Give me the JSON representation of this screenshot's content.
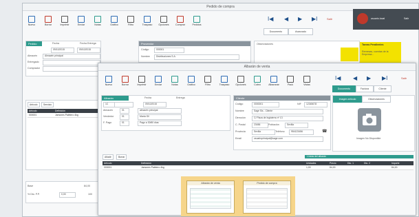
{
  "colors": {
    "accent": "#2e9b8d",
    "topbar": "#444b52",
    "highlight": "#f3e200",
    "preview_bg": "#f6d58a"
  },
  "back_window": {
    "title": "Pedido de compra",
    "toolbar": [
      {
        "label": "Nuevo",
        "icon": "new-doc-icon",
        "color": "#2f6db5"
      },
      {
        "label": "Borrar",
        "icon": "delete-doc-icon",
        "color": "#c0392b"
      },
      {
        "label": "Imprimir",
        "icon": "print-icon",
        "color": "#555"
      },
      {
        "label": "Enviar",
        "icon": "mail-icon",
        "color": "#2f6db5"
      },
      {
        "label": "Notas",
        "icon": "notes-icon",
        "color": "#2e9b8d"
      },
      {
        "label": "Gráfico",
        "icon": "chart-icon",
        "color": "#2f6db5"
      },
      {
        "label": "Filtro",
        "icon": "filter-icon",
        "color": "#555"
      },
      {
        "label": "Traspaso",
        "icon": "transfer-icon",
        "color": "#2f6db5"
      },
      {
        "label": "Opciones",
        "icon": "gear-icon",
        "color": "#555"
      },
      {
        "label": "Comprar",
        "icon": "cart-icon",
        "color": "#c0392b"
      },
      {
        "label": "Pedidos",
        "icon": "orders-icon",
        "color": "#2e9b8d"
      }
    ],
    "nav": {
      "first": "I◀",
      "prev": "◀",
      "next": "▶",
      "last": "▶I",
      "exit": "Salir"
    },
    "nav_tabs": [
      "Documento",
      "Avanzado"
    ],
    "order": {
      "header": "Pedido",
      "fecha_label": "Fecha",
      "fecha": "09/10/2015",
      "entrega_label": "Fecha Entrega",
      "entrega": "09/10/2015",
      "almacen_label": "Almacén",
      "almacen": "Almacén principal",
      "entregado_label": "Entregado",
      "comprador_label": "Comprador"
    },
    "provider": {
      "header": "Proveedor",
      "codigo_label": "Código",
      "codigo": "000001",
      "nombre_label": "Nombre",
      "nombre": "Distribuciones S.A."
    },
    "observaciones": "Observaciones",
    "tareas": {
      "title": "Tareas Pendientes",
      "body": "Remesas, cuentas de la Empresa..."
    },
    "user": "usuario.local",
    "exit": "Salir",
    "lower_tabs": [
      "Artículo",
      "Servicio"
    ],
    "grid_headers": [
      "Artículo",
      "Definición"
    ],
    "grid_row": [
      "000001",
      "Jamones Paletero 4kg"
    ],
    "bottom": {
      "base_label": "Base",
      "base_value": "84,00",
      "iva_label": "% Dto. P.P.",
      "iva_value": "0,00",
      "total_value": "100"
    }
  },
  "front_window": {
    "title": "Albarán de venta",
    "toolbar": [
      {
        "label": "Nuevo",
        "icon": "new-doc-icon",
        "color": "#2f6db5"
      },
      {
        "label": "Borrar",
        "icon": "delete-doc-icon",
        "color": "#c0392b"
      },
      {
        "label": "Imprimir",
        "icon": "print-icon",
        "color": "#555"
      },
      {
        "label": "Enviar",
        "icon": "mail-icon",
        "color": "#2f6db5"
      },
      {
        "label": "Notas",
        "icon": "notes-icon",
        "color": "#2e9b8d"
      },
      {
        "label": "Gráfico",
        "icon": "chart-icon",
        "color": "#2f6db5"
      },
      {
        "label": "Filtro",
        "icon": "filter-icon",
        "color": "#555"
      },
      {
        "label": "Traspaso",
        "icon": "transfer-icon",
        "color": "#2f6db5"
      },
      {
        "label": "Opciones",
        "icon": "gear-icon",
        "color": "#555"
      },
      {
        "label": "Cobro",
        "icon": "payment-icon",
        "color": "#2e9b8d"
      },
      {
        "label": "Albaranar",
        "icon": "delivery-icon",
        "color": "#2f6db5"
      },
      {
        "label": "Pack",
        "icon": "pack-icon",
        "color": "#555"
      },
      {
        "label": "Vistas",
        "icon": "views-icon",
        "color": "#555"
      }
    ],
    "nav": {
      "first": "I◀",
      "prev": "◀",
      "next": "▶",
      "last": "▶I",
      "exit": "Salir"
    },
    "nav_tabs": [
      "Documento",
      "Factura",
      "Cliente"
    ],
    "doc": {
      "header": "Albarán",
      "serie": "1C",
      "fecha_label": "Fecha",
      "fecha": "09/10/2015",
      "entrega_label": "Entrega",
      "almacen_label": "Almacén",
      "almacen_val": "01",
      "almacen_name": "almacén principal",
      "vendedor_label": "Vendedor",
      "vendedor_val": "01",
      "vendedor_name": "María Gil",
      "fpago_label": "F. Pago",
      "fpago_val": "01",
      "fpago_name": "Pago a 30/60 días"
    },
    "client": {
      "header": "Cliente",
      "codigo_label": "Código",
      "codigo": "0000001",
      "nif_label": "NIF",
      "nif": "12345678",
      "nombre_label": "Nombre",
      "nombre": "Sage Sis - Cliente",
      "direccion_label": "Dirección",
      "direccion": "C/ Plaza de Inglaterra nº 13",
      "cpostal_label": "C. Postal",
      "cpostal": "23456",
      "poblacion_label": "Población",
      "poblacion": "Sevilla",
      "provincia_label": "Provincia",
      "provincia": "Sevilla",
      "telefono_label": "Teléfono",
      "telefono": "954123456",
      "email_label": "Email",
      "email": "usuarioprincipal@sage.com"
    },
    "image_tabs": [
      "Imagen artículo",
      "Observaciones"
    ],
    "image_caption": "Imagen No Disponible",
    "lower_tabs": [
      "Añadir",
      "Borrar"
    ],
    "green_bar": "Líneas del albarán",
    "grid_headers": [
      "Artículo",
      "Definición",
      "Unidades",
      "Precio",
      "Dto. 1",
      "Dto. 2",
      "Importe"
    ],
    "grid_row": [
      "000001",
      "Jamones Paletero 4kg",
      "1,00",
      "84,00",
      "",
      "",
      "84,00"
    ]
  },
  "previews": [
    {
      "title": "Albarán de venta"
    },
    {
      "title": "Pedido de compra"
    }
  ]
}
